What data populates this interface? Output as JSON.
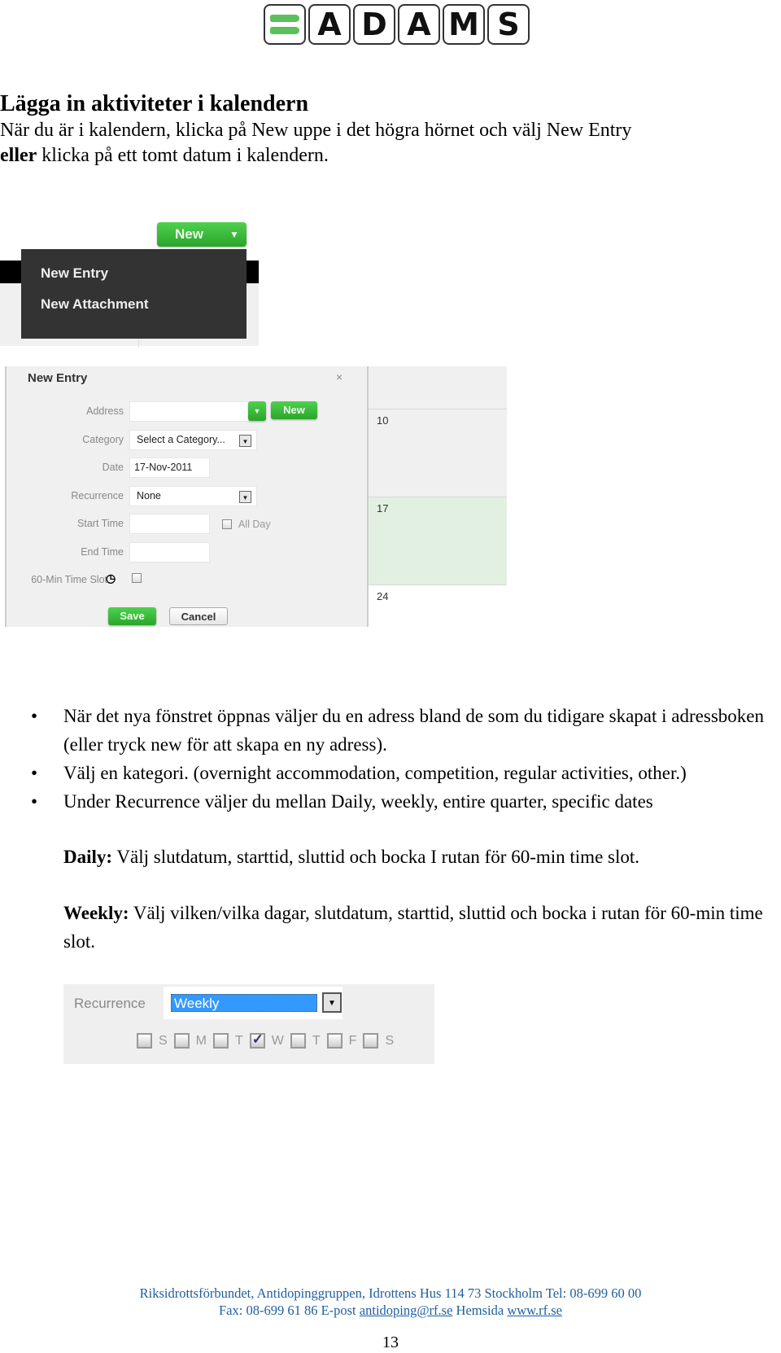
{
  "logo": {
    "letters": [
      "A",
      "D",
      "A",
      "M",
      "S"
    ],
    "accent_color": "#5bbf5b"
  },
  "heading": "Lägga in aktiviteter i kalendern",
  "intro": {
    "line1": "När du är i kalendern, klicka på New uppe i det högra hörnet och välj New Entry",
    "line2_bold": "eller",
    "line2_rest": " klicka på ett tomt datum i kalendern."
  },
  "menu_screenshot": {
    "new_button": "New",
    "items": [
      "New Entry",
      "New Attachment"
    ]
  },
  "dialog_screenshot": {
    "title": "New Entry",
    "close": "×",
    "fields": {
      "address_label": "Address",
      "address_value": "",
      "address_new_button": "New",
      "category_label": "Category",
      "category_value": "Select a Category...",
      "date_label": "Date",
      "date_value": "17-Nov-2011",
      "recurrence_label": "Recurrence",
      "recurrence_value": "None",
      "start_time_label": "Start Time",
      "start_time_value": "",
      "all_day_label": "All Day",
      "end_time_label": "End Time",
      "end_time_value": "",
      "slot_label": "60-Min Time Slot"
    },
    "save": "Save",
    "cancel": "Cancel",
    "calendar_days": [
      "10",
      "17",
      "24"
    ]
  },
  "bullets": [
    "När det nya fönstret öppnas väljer du en adress bland de som du tidigare skapat i adressboken (eller tryck new för att skapa en ny adress).",
    "Välj en kategori. (overnight accommodation, competition, regular activities, other.)",
    "Under Recurrence väljer du mellan Daily, weekly, entire quarter, specific dates"
  ],
  "daily": {
    "label": "Daily:",
    "text": " Välj slutdatum, starttid, sluttid och bocka I rutan för 60-min time slot."
  },
  "weekly": {
    "label": "Weekly:",
    "text": " Välj vilken/vilka dagar, slutdatum, starttid, sluttid och bocka i rutan för 60-min time slot."
  },
  "weekly_screenshot": {
    "label": "Recurrence",
    "value": "Weekly",
    "days": [
      {
        "label": "S",
        "checked": false
      },
      {
        "label": "M",
        "checked": false
      },
      {
        "label": "T",
        "checked": false
      },
      {
        "label": "W",
        "checked": true
      },
      {
        "label": "T",
        "checked": false
      },
      {
        "label": "F",
        "checked": false
      },
      {
        "label": "S",
        "checked": false
      }
    ]
  },
  "footer": {
    "line1": "Riksidrottsförbundet, Antidopinggruppen, Idrottens Hus 114 73 Stockholm Tel: 08-699 60 00",
    "fax": "Fax: 08-699 61 86 E-post ",
    "email": "antidoping@rf.se",
    "hemsida": " Hemsida ",
    "web": "www.rf.se",
    "page_number": "13"
  }
}
